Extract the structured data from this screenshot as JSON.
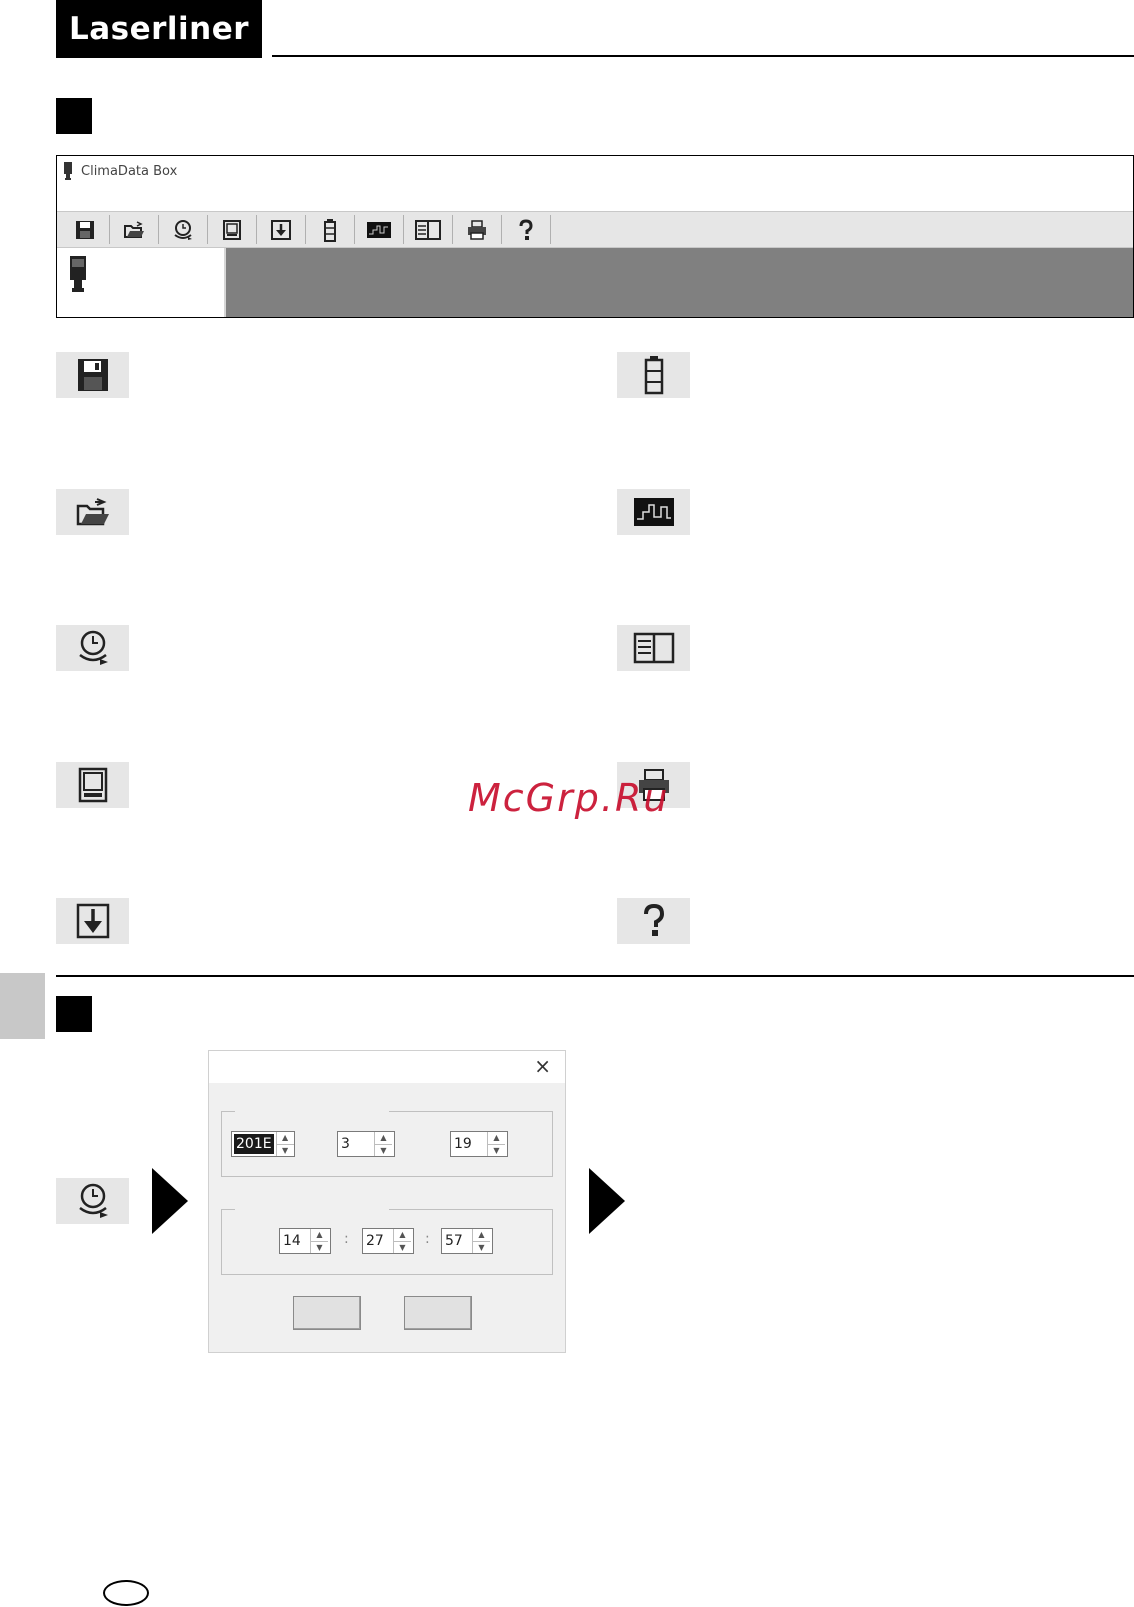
{
  "brand": {
    "logo_text": "Laserliner"
  },
  "app_window": {
    "title": "ClimaData Box",
    "toolbar_icons": [
      "save-icon",
      "open-folder-icon",
      "clock-icon",
      "device-icon",
      "download-icon",
      "battery-icon",
      "chart-icon",
      "table-icon",
      "printer-icon",
      "help-icon"
    ]
  },
  "icon_legend": {
    "left": [
      "save-icon",
      "open-folder-icon",
      "clock-icon",
      "device-icon",
      "download-icon"
    ],
    "right": [
      "battery-icon",
      "chart-icon",
      "table-icon",
      "printer-icon",
      "help-icon"
    ]
  },
  "watermark": "McGrp.Ru",
  "datetime_dialog": {
    "close_symbol": "×",
    "date": {
      "year": "201E",
      "month": "3",
      "day": "19"
    },
    "time": {
      "hour": "14",
      "minute": "27",
      "second": "57",
      "separator": ":"
    },
    "spin_up": "▲",
    "spin_down": "▼"
  }
}
